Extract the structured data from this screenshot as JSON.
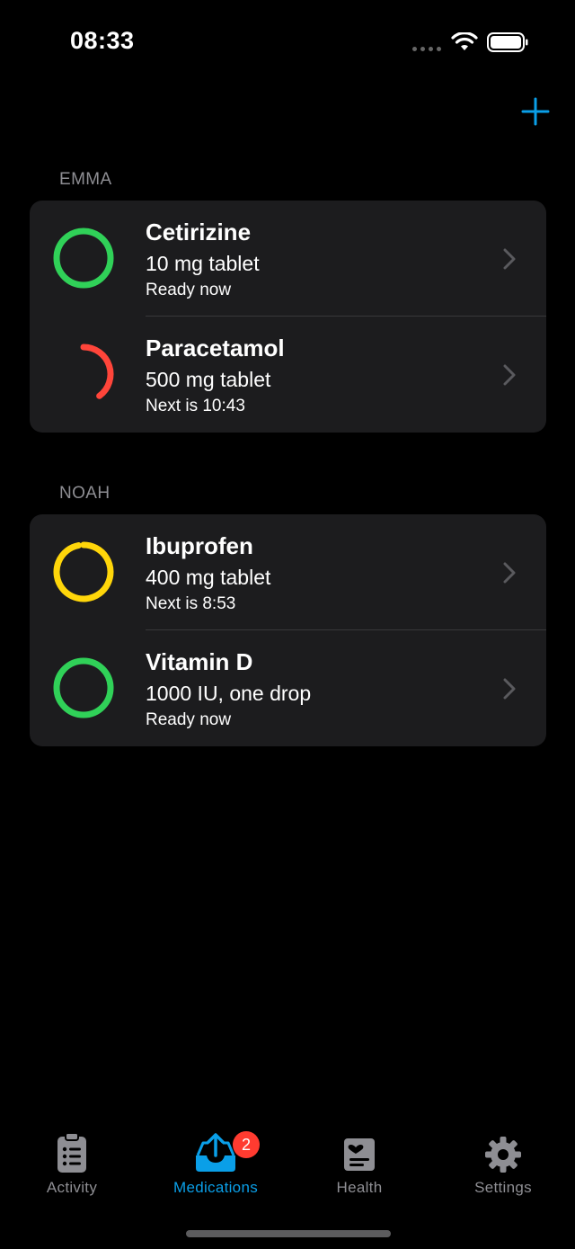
{
  "status_bar": {
    "time": "08:33"
  },
  "colors": {
    "accent": "#0a9fe8",
    "ready": "#30d158",
    "overdue": "#ff453a",
    "upcoming": "#ffd60a",
    "badge": "#ff3b30"
  },
  "sections": [
    {
      "title": "EMMA",
      "items": [
        {
          "name": "Cetirizine",
          "dose": "10 mg tablet",
          "status": "Ready now",
          "ring_color": "#30d158",
          "progress": 1.0
        },
        {
          "name": "Paracetamol",
          "dose": "500 mg tablet",
          "status": "Next is 10:43",
          "ring_color": "#ff453a",
          "progress": 0.4
        }
      ]
    },
    {
      "title": "NOAH",
      "items": [
        {
          "name": "Ibuprofen",
          "dose": "400 mg tablet",
          "status": "Next is 8:53",
          "ring_color": "#ffd60a",
          "progress": 0.97
        },
        {
          "name": "Vitamin D",
          "dose": "1000 IU, one drop",
          "status": "Ready now",
          "ring_color": "#30d158",
          "progress": 1.0
        }
      ]
    }
  ],
  "tabs": [
    {
      "label": "Activity",
      "icon": "clipboard-icon",
      "active": false
    },
    {
      "label": "Medications",
      "icon": "tray-upload-icon",
      "active": true,
      "badge": "2"
    },
    {
      "label": "Health",
      "icon": "health-card-icon",
      "active": false
    },
    {
      "label": "Settings",
      "icon": "gear-icon",
      "active": false
    }
  ]
}
